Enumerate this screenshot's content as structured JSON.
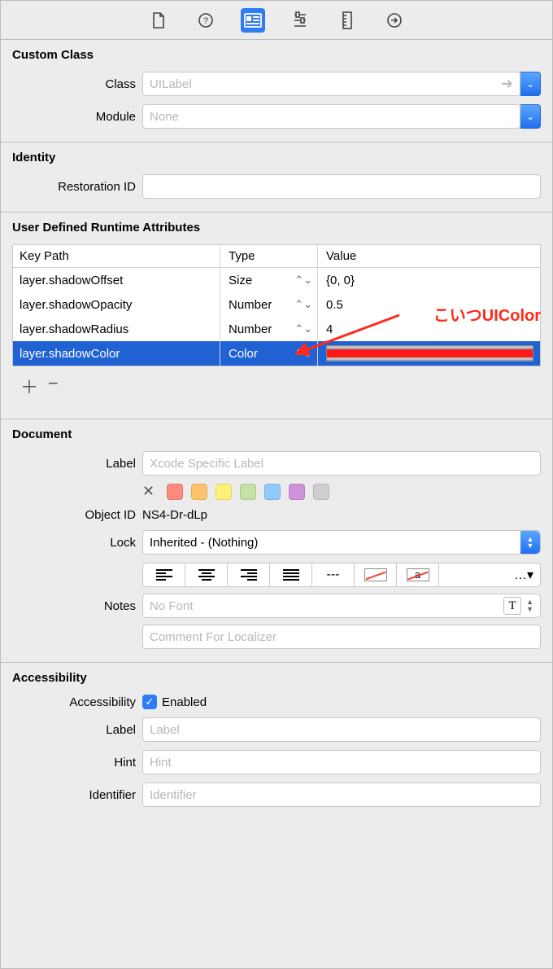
{
  "sections": {
    "custom_class": {
      "title": "Custom Class",
      "class_label": "Class",
      "class_value": "UILabel",
      "module_label": "Module",
      "module_value": "None"
    },
    "identity": {
      "title": "Identity",
      "restoration_label": "Restoration ID",
      "restoration_value": ""
    },
    "udra": {
      "title": "User Defined Runtime Attributes",
      "head_keypath": "Key Path",
      "head_type": "Type",
      "head_value": "Value",
      "rows": [
        {
          "keypath": "layer.shadowOffset",
          "type": "Size",
          "value": "{0, 0}"
        },
        {
          "keypath": "layer.shadowOpacity",
          "type": "Number",
          "value": "0.5"
        },
        {
          "keypath": "layer.shadowRadius",
          "type": "Number",
          "value": "4"
        },
        {
          "keypath": "layer.shadowColor",
          "type": "Color",
          "value": "#ff1a1a"
        }
      ]
    },
    "document": {
      "title": "Document",
      "label_label": "Label",
      "label_placeholder": "Xcode Specific Label",
      "objectid_label": "Object ID",
      "objectid_value": "NS4-Dr-dLp",
      "lock_label": "Lock",
      "lock_value": "Inherited - (Nothing)",
      "notes_label": "Notes",
      "nofont": "No Font",
      "comment_placeholder": "Comment For Localizer",
      "swatch_colors": [
        "#ff8a80",
        "#ffc46b",
        "#fff176",
        "#c5e1a5",
        "#90caf9",
        "#ce93d8",
        "#cfcfcf"
      ]
    },
    "accessibility": {
      "title": "Accessibility",
      "accessibility_label": "Accessibility",
      "enabled_text": "Enabled",
      "label_label": "Label",
      "label_placeholder": "Label",
      "hint_label": "Hint",
      "hint_placeholder": "Hint",
      "identifier_label": "Identifier",
      "identifier_placeholder": "Identifier"
    }
  },
  "annotation": {
    "text": "こいつUIColor"
  }
}
